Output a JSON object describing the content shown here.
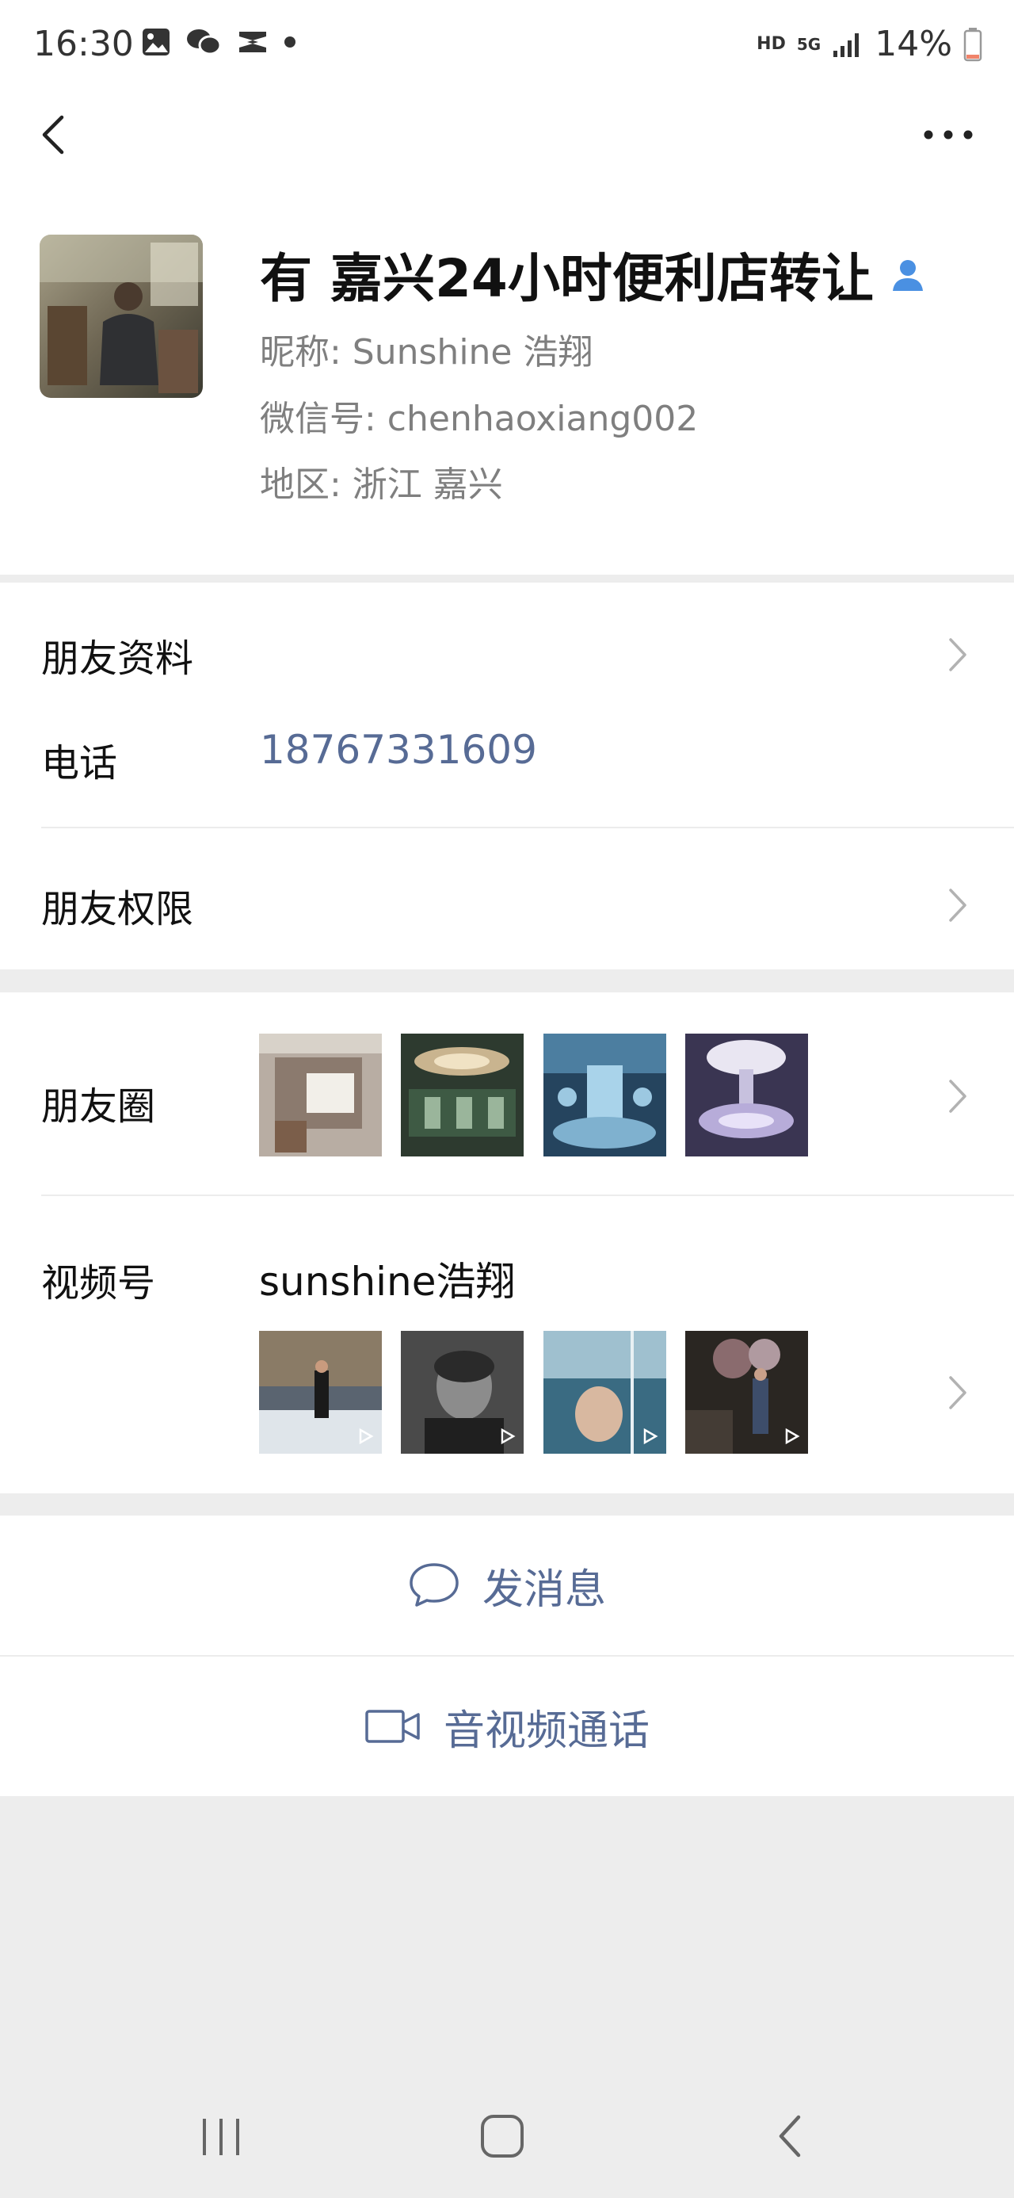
{
  "status_bar": {
    "time": "16:30",
    "network": "HD",
    "signal_type": "5G",
    "battery": "14%",
    "left_icons": [
      "gallery-icon",
      "wechat-icon",
      "capcut-icon",
      "dot-icon"
    ]
  },
  "nav": {
    "back_icon": "chevron-left-icon",
    "more_icon": "more-dots-icon"
  },
  "profile": {
    "display_name": "有 嘉兴24小时便利店转让",
    "nickname": "昵称: Sunshine 浩翔",
    "wechat_id": "微信号: chenhaoxiang002",
    "region": "地区: 浙江  嘉兴",
    "badge_icon": "contact-person-icon"
  },
  "rows": {
    "friend_info_label": "朋友资料",
    "phone_label": "电话",
    "phone_value": "18767331609",
    "permissions_label": "朋友权限",
    "moments_label": "朋友圈",
    "channels_label": "视频号",
    "channels_name": "sunshine浩翔"
  },
  "actions": {
    "message_label": "发消息",
    "call_label": "音视频通话"
  },
  "colors": {
    "link_blue": "#576b95",
    "badge_blue": "#4a90e2",
    "background": "#ededed"
  }
}
